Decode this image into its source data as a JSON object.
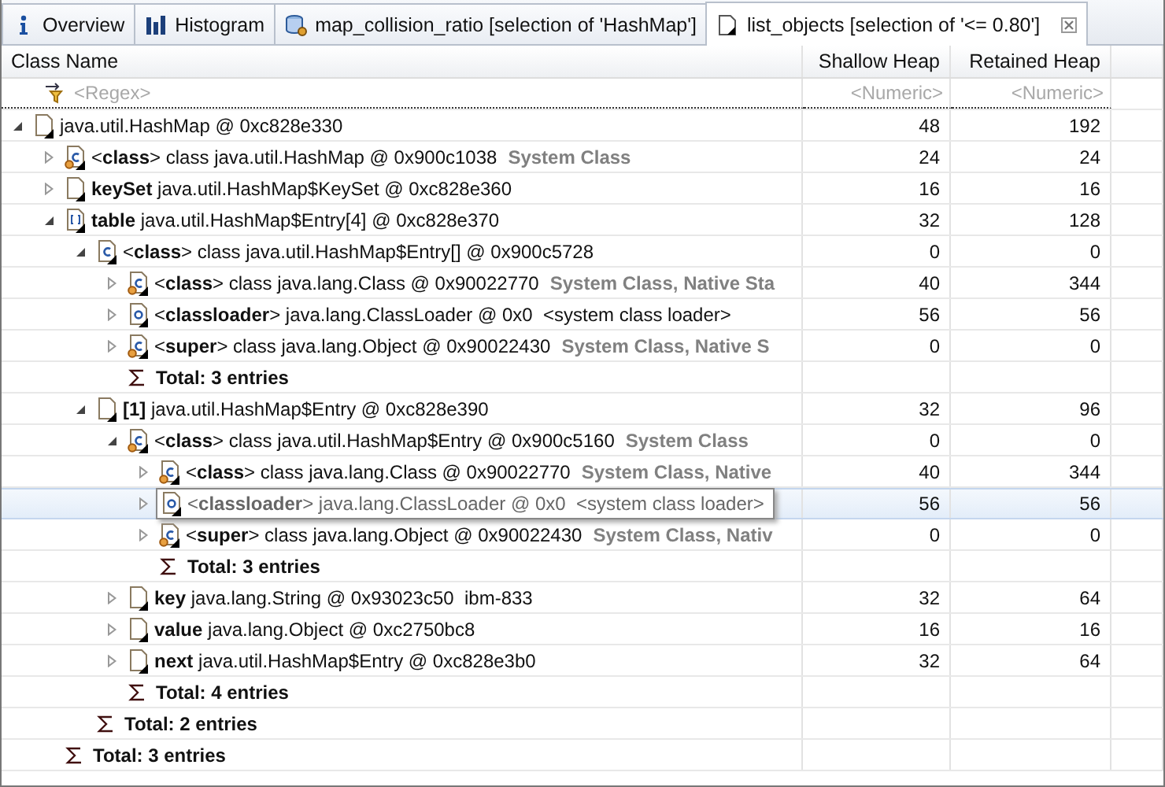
{
  "tabs": [
    {
      "label": "Overview",
      "kind": "info",
      "selected": false
    },
    {
      "label": "Histogram",
      "kind": "histogram",
      "selected": false
    },
    {
      "label": "map_collision_ratio [selection of 'HashMap']",
      "kind": "query",
      "selected": false
    },
    {
      "label": "list_objects [selection of '<= 0.80']",
      "kind": "objects",
      "selected": true
    }
  ],
  "table": {
    "columns": [
      "Class Name",
      "Shallow Heap",
      "Retained Heap"
    ],
    "filter": {
      "name_placeholder": "<Regex>",
      "shallow_placeholder": "<Numeric>",
      "retained_placeholder": "<Numeric>"
    },
    "rows": [
      {
        "kind": "object",
        "static": false,
        "expanded": true,
        "hovered": false,
        "name": "java.util.HashMap @ 0xc828e330",
        "shallow": "48",
        "retained": "192",
        "children": [
          {
            "kind": "class",
            "static": true,
            "expanded": false,
            "hovered": false,
            "name": "<**class**> class java.util.HashMap @ 0x900c1038",
            "note": "System Class",
            "shallow": "24",
            "retained": "24"
          },
          {
            "kind": "object",
            "static": false,
            "expanded": false,
            "hovered": false,
            "name": "**keySet** java.util.HashMap$KeySet @ 0xc828e360",
            "shallow": "16",
            "retained": "16"
          },
          {
            "kind": "array",
            "static": false,
            "expanded": true,
            "hovered": false,
            "name": "**table** java.util.HashMap$Entry[4] @ 0xc828e370",
            "shallow": "32",
            "retained": "128",
            "children": [
              {
                "kind": "class",
                "static": false,
                "expanded": true,
                "hovered": false,
                "name": "<**class**> class java.util.HashMap$Entry[] @ 0x900c5728",
                "shallow": "0",
                "retained": "0",
                "children": [
                  {
                    "kind": "class",
                    "static": true,
                    "expanded": false,
                    "hovered": false,
                    "name": "<**class**> class java.lang.Class @ 0x90022770",
                    "note": "System Class, Native Sta",
                    "shallow": "40",
                    "retained": "344"
                  },
                  {
                    "kind": "loader",
                    "static": false,
                    "expanded": false,
                    "hovered": false,
                    "name": "<**classloader**> java.lang.ClassLoader @ 0x0  <system class loader>",
                    "shallow": "56",
                    "retained": "56"
                  },
                  {
                    "kind": "class",
                    "static": true,
                    "expanded": false,
                    "hovered": false,
                    "name": "<**super**> class java.lang.Object @ 0x90022430",
                    "note": "System Class, Native S",
                    "shallow": "0",
                    "retained": "0"
                  },
                  {
                    "kind": "total",
                    "name": "Total: 3 entries"
                  }
                ]
              },
              {
                "kind": "object",
                "static": false,
                "expanded": true,
                "hovered": false,
                "name": "**[1]** java.util.HashMap$Entry @ 0xc828e390",
                "shallow": "32",
                "retained": "96",
                "children": [
                  {
                    "kind": "class",
                    "static": true,
                    "expanded": true,
                    "hovered": false,
                    "name": "<**class**> class java.util.HashMap$Entry @ 0x900c5160",
                    "note": "System Class",
                    "shallow": "0",
                    "retained": "0",
                    "children": [
                      {
                        "kind": "class",
                        "static": true,
                        "expanded": false,
                        "hovered": false,
                        "name": "<**class**> class java.lang.Class @ 0x90022770",
                        "note": "System Class, Native",
                        "shallow": "40",
                        "retained": "344"
                      },
                      {
                        "kind": "loader",
                        "static": false,
                        "expanded": false,
                        "hovered": true,
                        "name": "<**classloader**> java.lang.ClassLoader @ 0x0  <system class loader>",
                        "shallow": "56",
                        "retained": "56"
                      },
                      {
                        "kind": "class",
                        "static": true,
                        "expanded": false,
                        "hovered": false,
                        "name": "<**super**> class java.lang.Object @ 0x90022430",
                        "note": "System Class, Nativ",
                        "shallow": "0",
                        "retained": "0"
                      },
                      {
                        "kind": "total",
                        "name": "Total: 3 entries"
                      }
                    ]
                  },
                  {
                    "kind": "object",
                    "static": false,
                    "expanded": false,
                    "hovered": false,
                    "name": "**key** java.lang.String @ 0x93023c50  ibm-833",
                    "shallow": "32",
                    "retained": "64"
                  },
                  {
                    "kind": "object",
                    "static": false,
                    "expanded": false,
                    "hovered": false,
                    "name": "**value** java.lang.Object @ 0xc2750bc8",
                    "shallow": "16",
                    "retained": "16"
                  },
                  {
                    "kind": "object",
                    "static": false,
                    "expanded": false,
                    "hovered": false,
                    "name": "**next** java.util.HashMap$Entry @ 0xc828e3b0",
                    "shallow": "32",
                    "retained": "64"
                  },
                  {
                    "kind": "total",
                    "name": "Total: 4 entries"
                  }
                ]
              },
              {
                "kind": "total",
                "name": "Total: 2 entries"
              }
            ]
          },
          {
            "kind": "total",
            "name": "Total: 3 entries"
          }
        ]
      }
    ]
  }
}
